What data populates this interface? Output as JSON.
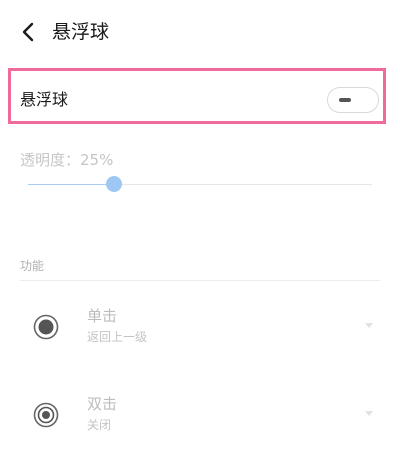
{
  "header": {
    "title": "悬浮球"
  },
  "floating_ball": {
    "label": "悬浮球",
    "enabled": false
  },
  "opacity": {
    "label": "透明度：25%",
    "value": 0.25
  },
  "functions": {
    "section_title": "功能",
    "items": [
      {
        "title": "单击",
        "subtitle": "返回上一级",
        "icon": "radio-filled-icon"
      },
      {
        "title": "双击",
        "subtitle": "关闭",
        "icon": "target-ring-icon"
      }
    ]
  },
  "colors": {
    "highlight": "#f06a9e",
    "slider_accent": "#9ec8f3"
  }
}
